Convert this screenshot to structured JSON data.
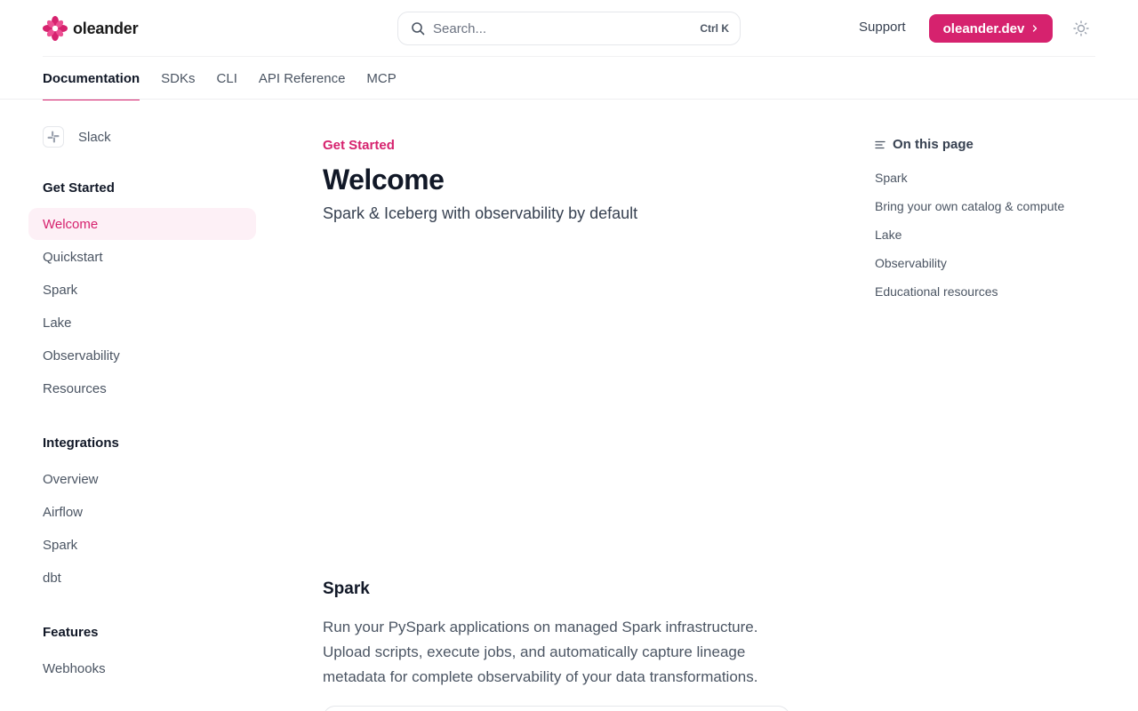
{
  "header": {
    "logo_text": "oleander",
    "search_placeholder": "Search...",
    "search_shortcut": "Ctrl K",
    "support_label": "Support",
    "cta_label": "oleander.dev"
  },
  "tabs": [
    {
      "label": "Documentation",
      "active": true
    },
    {
      "label": "SDKs"
    },
    {
      "label": "CLI"
    },
    {
      "label": "API Reference"
    },
    {
      "label": "MCP"
    }
  ],
  "sidebar": {
    "slack_label": "Slack",
    "groups": [
      {
        "title": "Get Started",
        "items": [
          "Welcome",
          "Quickstart",
          "Spark",
          "Lake",
          "Observability",
          "Resources"
        ],
        "active_item": "Welcome"
      },
      {
        "title": "Integrations",
        "items": [
          "Overview",
          "Airflow",
          "Spark",
          "dbt"
        ]
      },
      {
        "title": "Features",
        "items": [
          "Webhooks"
        ]
      }
    ]
  },
  "main": {
    "eyebrow": "Get Started",
    "title": "Welcome",
    "subtitle": "Spark & Iceberg with observability by default",
    "section_title": "Spark",
    "section_body": "Run your PySpark applications on managed Spark infrastructure. Upload scripts, execute jobs, and automatically capture lineage metadata for complete observability of your data transformations."
  },
  "toc": {
    "heading": "On this page",
    "items": [
      "Spark",
      "Bring your own catalog & compute",
      "Lake",
      "Observability",
      "Educational resources"
    ]
  },
  "colors": {
    "accent": "#d6226e",
    "accent_bg": "#fdf0f6",
    "text_primary": "#111827",
    "text_secondary": "#4b5563"
  }
}
